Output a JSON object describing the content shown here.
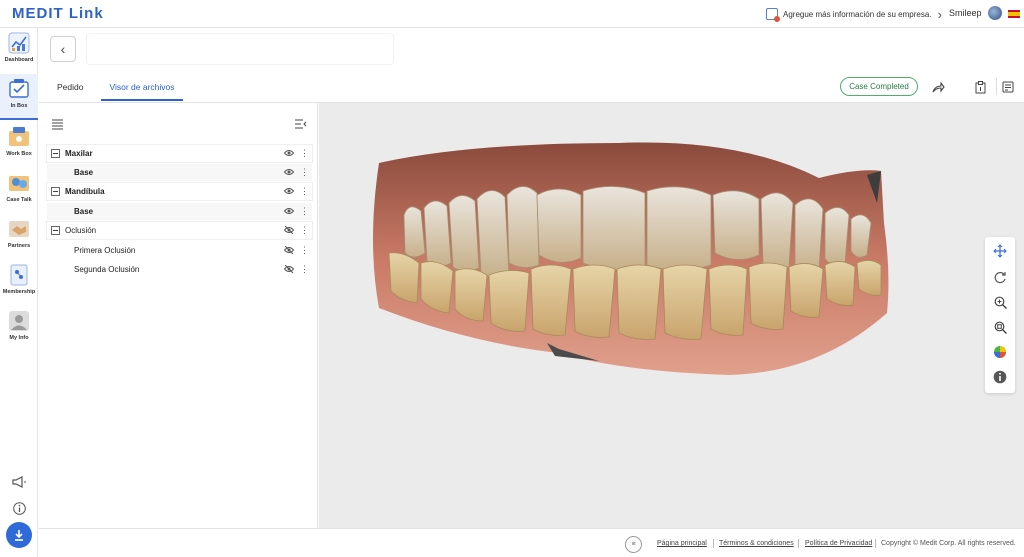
{
  "app": {
    "logo": "MEDIT Link"
  },
  "topbar": {
    "notice": "Agregue más información de su empresa.",
    "user_name": "Smileep"
  },
  "nav": {
    "items": [
      {
        "label": "Dashboard",
        "icon": "dashboard-icon",
        "color": "#4a7bd0"
      },
      {
        "label": "In Box",
        "icon": "inbox-icon",
        "color": "#3b6fd6",
        "active": true
      },
      {
        "label": "Work Box",
        "icon": "workbox-icon",
        "color": "#e0a03c"
      },
      {
        "label": "Case Talk",
        "icon": "casetalk-icon",
        "color": "#4c8fd4"
      },
      {
        "label": "Partners",
        "icon": "partners-icon",
        "color": "#d9a46a"
      },
      {
        "label": "Membership",
        "icon": "membership-icon",
        "color": "#3b6fd6"
      },
      {
        "label": "My Info",
        "icon": "myinfo-icon",
        "color": "#9a9a9a"
      }
    ]
  },
  "header": {
    "tabs": [
      {
        "label": "Pedido",
        "selected": false
      },
      {
        "label": "Visor de archivos",
        "selected": true
      }
    ],
    "status_button": "Case Completed"
  },
  "tree": {
    "rows": [
      {
        "label": "Maxilar",
        "bold": true,
        "group": true,
        "visible": true
      },
      {
        "label": "Base",
        "bold": true,
        "group": false,
        "visible": true
      },
      {
        "label": "Mandíbula",
        "bold": true,
        "group": true,
        "visible": true
      },
      {
        "label": "Base",
        "bold": true,
        "group": false,
        "visible": true
      },
      {
        "label": "Oclusión",
        "bold": false,
        "group": true,
        "visible": false
      },
      {
        "label": "Primera Oclusión",
        "bold": false,
        "group": false,
        "visible": false
      },
      {
        "label": "Segunda Oclusión",
        "bold": false,
        "group": false,
        "visible": false
      }
    ]
  },
  "viewer": {
    "tools": [
      "move-icon",
      "rotate-icon",
      "zoom-in-icon",
      "zoom-fit-icon",
      "color-map-icon",
      "info-icon"
    ]
  },
  "footer": {
    "links": [
      "Página principal",
      "Términos & condiciones",
      "Política de Privacidad"
    ],
    "copyright": "Copyright © Medit Corp. All rights reserved."
  },
  "colors": {
    "accent": "#2e62c8",
    "status_green": "#4caf6a",
    "viewport_bg": "#ebebeb"
  }
}
